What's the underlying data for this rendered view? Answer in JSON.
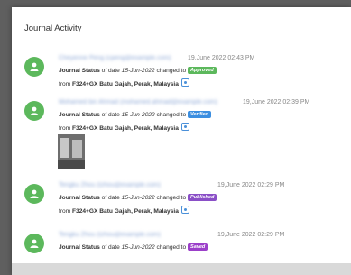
{
  "panel": {
    "title": "Journal Activity"
  },
  "entries": [
    {
      "user": "Cheyenne Peng (cpeng@example.com)",
      "timestamp": "19,June 2022 02:43 PM",
      "prefix": "Journal Status",
      "of_date": "of date",
      "date": "15-Jun-2022",
      "changed_to": "changed to",
      "status": "Approved",
      "status_color": "#5cb85c",
      "from": "from",
      "location": "F324+GX Batu Gajah, Perak, Malaysia"
    },
    {
      "user": "Mohamed bin Ahmad (mohamed.ahmad@example.com)",
      "timestamp": "19,June 2022 02:39 PM",
      "prefix": "Journal Status",
      "of_date": "of date",
      "date": "15-Jun-2022",
      "changed_to": "changed to",
      "status": "Verified",
      "status_color": "#3b8ee0",
      "from": "from",
      "location": "F324+GX Batu Gajah, Perak, Malaysia"
    },
    {
      "user": "Tengku Zhou (tzhou@example.com)",
      "timestamp": "19,June 2022 02:29 PM",
      "prefix": "Journal Status",
      "of_date": "of date",
      "date": "15-Jun-2022",
      "changed_to": "changed to",
      "status": "Published",
      "status_color": "#8a4fc7",
      "from": "from",
      "location": "F324+GX Batu Gajah, Perak, Malaysia"
    },
    {
      "user": "Tengku Zhou (tzhou@example.com)",
      "timestamp": "19,June 2022 02:29 PM",
      "prefix": "Journal Status",
      "of_date": "of date",
      "date": "15-Jun-2022",
      "changed_to": "changed to",
      "status": "Saved",
      "status_color": "#9b3fc9"
    }
  ]
}
